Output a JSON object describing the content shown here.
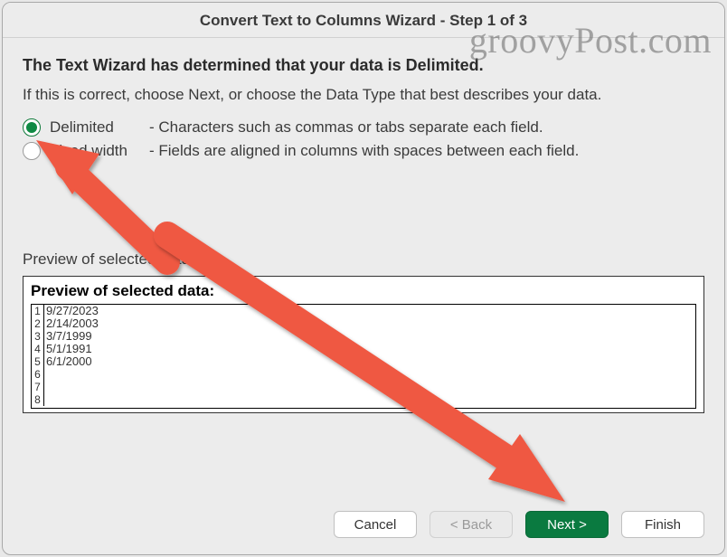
{
  "title": "Convert Text to Columns Wizard - Step 1 of 3",
  "watermark": "groovyPost.com",
  "heading": "The Text Wizard has determined that your data is Delimited.",
  "subtext": "If this is correct, choose Next, or choose the Data Type that best describes your data.",
  "options": {
    "delimited": {
      "label": "Delimited",
      "desc": "-  Characters such as commas or tabs separate each field.",
      "selected": true
    },
    "fixed": {
      "label": "Fixed width",
      "desc": "-  Fields are aligned in columns with spaces between each field.",
      "selected": false
    }
  },
  "preview": {
    "label": "Preview of selected data:",
    "title": "Preview of selected data:",
    "rows": [
      {
        "idx": "1",
        "val": "9/27/2023"
      },
      {
        "idx": "2",
        "val": "2/14/2003"
      },
      {
        "idx": "3",
        "val": "3/7/1999"
      },
      {
        "idx": "4",
        "val": "5/1/1991"
      },
      {
        "idx": "5",
        "val": "6/1/2000"
      },
      {
        "idx": "6",
        "val": ""
      },
      {
        "idx": "7",
        "val": ""
      },
      {
        "idx": "8",
        "val": ""
      }
    ]
  },
  "buttons": {
    "cancel": "Cancel",
    "back": "< Back",
    "next": "Next >",
    "finish": "Finish"
  }
}
